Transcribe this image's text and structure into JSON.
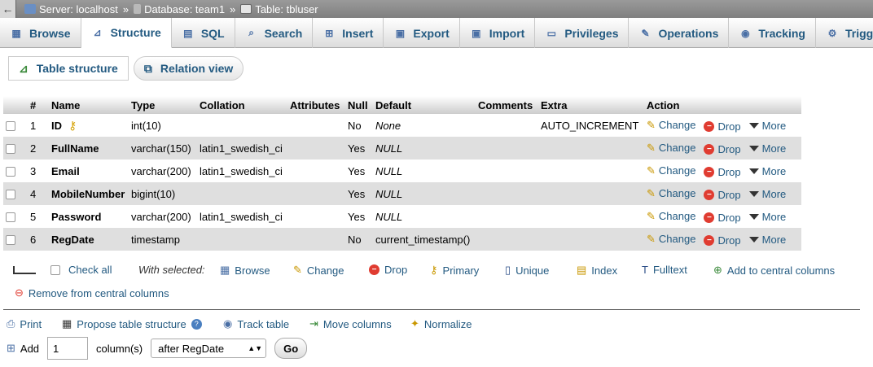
{
  "breadcrumb": {
    "back": "←",
    "server": "Server: localhost",
    "database": "Database: team1",
    "table": "Table: tbluser",
    "sep": "»"
  },
  "tabs": [
    {
      "label": "Browse",
      "icon": "browse-icon",
      "active": false
    },
    {
      "label": "Structure",
      "icon": "structure-icon",
      "active": true
    },
    {
      "label": "SQL",
      "icon": "sql-icon",
      "active": false
    },
    {
      "label": "Search",
      "icon": "search-icon",
      "active": false
    },
    {
      "label": "Insert",
      "icon": "insert-icon",
      "active": false
    },
    {
      "label": "Export",
      "icon": "export-icon",
      "active": false
    },
    {
      "label": "Import",
      "icon": "import-icon",
      "active": false
    },
    {
      "label": "Privileges",
      "icon": "privileges-icon",
      "active": false
    },
    {
      "label": "Operations",
      "icon": "wrench-icon",
      "active": false
    },
    {
      "label": "Tracking",
      "icon": "eye-icon",
      "active": false
    },
    {
      "label": "Triggers",
      "icon": "triggers-icon",
      "active": false
    }
  ],
  "subtabs": {
    "table_structure": "Table structure",
    "relation_view": "Relation view"
  },
  "columns": [
    "#",
    "Name",
    "Type",
    "Collation",
    "Attributes",
    "Null",
    "Default",
    "Comments",
    "Extra",
    "Action"
  ],
  "actions": {
    "change": "Change",
    "drop": "Drop",
    "more": "More"
  },
  "rows": [
    {
      "num": "1",
      "name": "ID",
      "type": "int(10)",
      "collation": "",
      "attributes": "",
      "null": "No",
      "default": "None",
      "comments": "",
      "extra": "AUTO_INCREMENT"
    },
    {
      "num": "2",
      "name": "FullName",
      "type": "varchar(150)",
      "collation": "latin1_swedish_ci",
      "attributes": "",
      "null": "Yes",
      "default": "NULL",
      "comments": "",
      "extra": ""
    },
    {
      "num": "3",
      "name": "Email",
      "type": "varchar(200)",
      "collation": "latin1_swedish_ci",
      "attributes": "",
      "null": "Yes",
      "default": "NULL",
      "comments": "",
      "extra": ""
    },
    {
      "num": "4",
      "name": "MobileNumber",
      "type": "bigint(10)",
      "collation": "",
      "attributes": "",
      "null": "Yes",
      "default": "NULL",
      "comments": "",
      "extra": ""
    },
    {
      "num": "5",
      "name": "Password",
      "type": "varchar(200)",
      "collation": "latin1_swedish_ci",
      "attributes": "",
      "null": "Yes",
      "default": "NULL",
      "comments": "",
      "extra": ""
    },
    {
      "num": "6",
      "name": "RegDate",
      "type": "timestamp",
      "collation": "",
      "attributes": "",
      "null": "No",
      "default": "current_timestamp()",
      "comments": "",
      "extra": ""
    }
  ],
  "bulk": {
    "check_all": "Check all",
    "with_selected": "With selected:",
    "browse": "Browse",
    "change": "Change",
    "drop": "Drop",
    "primary": "Primary",
    "unique": "Unique",
    "index": "Index",
    "fulltext": "Fulltext",
    "add_central": "Add to central columns",
    "remove_central": "Remove from central columns"
  },
  "tools": {
    "print": "Print",
    "propose": "Propose table structure",
    "track": "Track table",
    "move": "Move columns",
    "normalize": "Normalize"
  },
  "add_columns": {
    "label": "Add",
    "count": "1",
    "unit": "column(s)",
    "position": "after RegDate",
    "go": "Go"
  }
}
